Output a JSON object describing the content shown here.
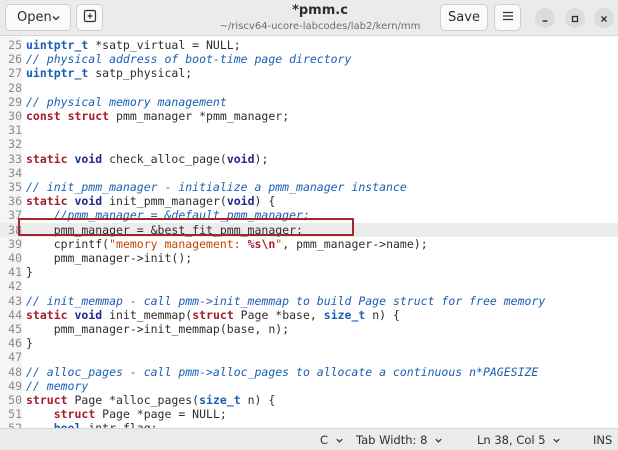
{
  "header": {
    "open_label": "Open",
    "title": "*pmm.c",
    "subtitle": "~/riscv64-ucore-labcodes/lab2/kern/mm",
    "save_label": "Save"
  },
  "icons": {
    "open_dropdown": "chevron-down-icon",
    "new_tab": "new-tab-icon",
    "menu": "hamburger-menu-icon",
    "minimize": "minimize-icon",
    "maximize": "maximize-icon",
    "close": "close-icon"
  },
  "colors": {
    "keyword": "#a51d2d",
    "type": "#26268c",
    "comment": "#1a5fb4",
    "string": "#c64600",
    "highlight_box": "#a4262c"
  },
  "editor": {
    "current_line": 38,
    "lines": [
      {
        "number": "25",
        "tokens": [
          {
            "t": "uintptr_t",
            "c": "tyn"
          },
          {
            "t": " *satp_virtual = NULL;",
            "c": ""
          }
        ]
      },
      {
        "number": "26",
        "tokens": [
          {
            "t": "// physical address of boot-time page directory",
            "c": "cm"
          }
        ]
      },
      {
        "number": "27",
        "tokens": [
          {
            "t": "uintptr_t",
            "c": "tyn"
          },
          {
            "t": " satp_physical;",
            "c": ""
          }
        ]
      },
      {
        "number": "28",
        "tokens": []
      },
      {
        "number": "29",
        "tokens": [
          {
            "t": "// physical memory management",
            "c": "cm"
          }
        ]
      },
      {
        "number": "30",
        "tokens": [
          {
            "t": "const",
            "c": "kw"
          },
          {
            "t": " ",
            "c": ""
          },
          {
            "t": "struct",
            "c": "kw"
          },
          {
            "t": " pmm_manager *pmm_manager;",
            "c": ""
          }
        ]
      },
      {
        "number": "31",
        "tokens": []
      },
      {
        "number": "32",
        "tokens": []
      },
      {
        "number": "33",
        "tokens": [
          {
            "t": "static",
            "c": "kw"
          },
          {
            "t": " ",
            "c": ""
          },
          {
            "t": "void",
            "c": "ty"
          },
          {
            "t": " check_alloc_page(",
            "c": ""
          },
          {
            "t": "void",
            "c": "ty"
          },
          {
            "t": ");",
            "c": ""
          }
        ]
      },
      {
        "number": "34",
        "tokens": []
      },
      {
        "number": "35",
        "tokens": [
          {
            "t": "// init_pmm_manager - initialize a pmm_manager instance",
            "c": "cm"
          }
        ]
      },
      {
        "number": "36",
        "tokens": [
          {
            "t": "static",
            "c": "kw"
          },
          {
            "t": " ",
            "c": ""
          },
          {
            "t": "void",
            "c": "ty"
          },
          {
            "t": " init_pmm_manager(",
            "c": ""
          },
          {
            "t": "void",
            "c": "ty"
          },
          {
            "t": ") {",
            "c": ""
          }
        ]
      },
      {
        "number": "37",
        "tokens": [
          {
            "t": "    //pmm_manager = &default_pmm_manager;",
            "c": "cm"
          }
        ]
      },
      {
        "number": "38",
        "tokens": [
          {
            "t": "    pmm_manager = &best_fit_pmm_manager;",
            "c": ""
          }
        ]
      },
      {
        "number": "39",
        "tokens": [
          {
            "t": "    cprintf(",
            "c": ""
          },
          {
            "t": "\"memory management: ",
            "c": "st"
          },
          {
            "t": "%s\\n",
            "c": "sp"
          },
          {
            "t": "\"",
            "c": "st"
          },
          {
            "t": ", pmm_manager->name);",
            "c": ""
          }
        ]
      },
      {
        "number": "40",
        "tokens": [
          {
            "t": "    pmm_manager->init();",
            "c": ""
          }
        ]
      },
      {
        "number": "41",
        "tokens": [
          {
            "t": "}",
            "c": ""
          }
        ]
      },
      {
        "number": "42",
        "tokens": []
      },
      {
        "number": "43",
        "tokens": [
          {
            "t": "// init_memmap - call pmm->init_memmap to build Page struct for free memory",
            "c": "cm"
          }
        ]
      },
      {
        "number": "44",
        "tokens": [
          {
            "t": "static",
            "c": "kw"
          },
          {
            "t": " ",
            "c": ""
          },
          {
            "t": "void",
            "c": "ty"
          },
          {
            "t": " init_memmap(",
            "c": ""
          },
          {
            "t": "struct",
            "c": "kw"
          },
          {
            "t": " Page *base, ",
            "c": ""
          },
          {
            "t": "size_t",
            "c": "tyn"
          },
          {
            "t": " n) {",
            "c": ""
          }
        ]
      },
      {
        "number": "45",
        "tokens": [
          {
            "t": "    pmm_manager->init_memmap(base, n);",
            "c": ""
          }
        ]
      },
      {
        "number": "46",
        "tokens": [
          {
            "t": "}",
            "c": ""
          }
        ]
      },
      {
        "number": "47",
        "tokens": []
      },
      {
        "number": "48",
        "tokens": [
          {
            "t": "// alloc_pages - call pmm->alloc_pages to allocate a continuous n*PAGESIZE",
            "c": "cm"
          }
        ]
      },
      {
        "number": "49",
        "tokens": [
          {
            "t": "// memory",
            "c": "cm"
          }
        ]
      },
      {
        "number": "50",
        "tokens": [
          {
            "t": "struct",
            "c": "kw"
          },
          {
            "t": " Page *alloc_pages(",
            "c": ""
          },
          {
            "t": "size_t",
            "c": "tyn"
          },
          {
            "t": " n) {",
            "c": ""
          }
        ]
      },
      {
        "number": "51",
        "tokens": [
          {
            "t": "    ",
            "c": ""
          },
          {
            "t": "struct",
            "c": "kw"
          },
          {
            "t": " Page *page = NULL;",
            "c": ""
          }
        ]
      },
      {
        "number": "52",
        "tokens": [
          {
            "t": "    ",
            "c": ""
          },
          {
            "t": "bool",
            "c": "tyn"
          },
          {
            "t": " intr_flag;",
            "c": ""
          }
        ]
      }
    ]
  },
  "statusbar": {
    "language": "C",
    "tab_width": "Tab Width: 8",
    "position": "Ln 38, Col 5",
    "mode": "INS"
  }
}
